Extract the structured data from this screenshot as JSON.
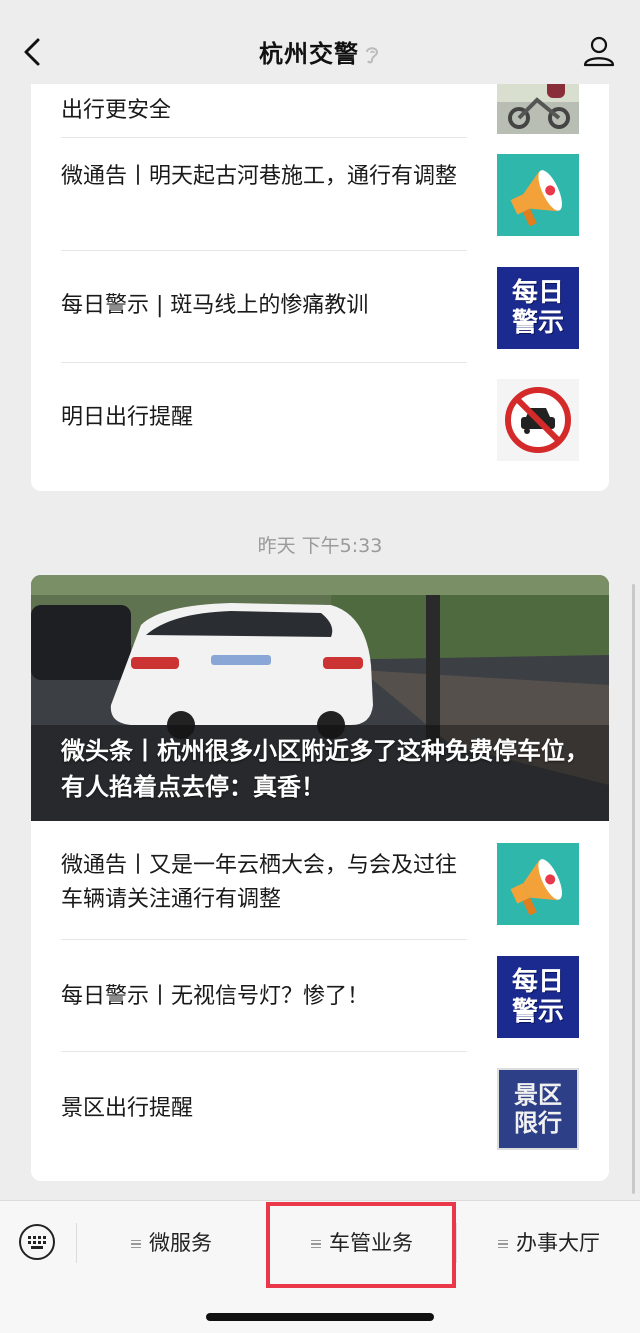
{
  "header": {
    "title": "杭州交警"
  },
  "card1": {
    "items": [
      {
        "title": "出行更安全",
        "thumb": "scooter-photo"
      },
      {
        "title": "微通告丨明天起古河巷施工，通行有调整",
        "thumb": "megaphone-icon"
      },
      {
        "title": "每日警示 | 斑马线上的惨痛教训",
        "thumb": "daily-warning",
        "thumb_text": [
          "每日",
          "警示"
        ]
      },
      {
        "title": "明日出行提醒",
        "thumb": "no-car-sign"
      }
    ]
  },
  "timestamp": "昨天 下午5:33",
  "card2": {
    "hero_caption": "微头条丨杭州很多小区附近多了这种免费停车位，有人掐着点去停：真香！",
    "items": [
      {
        "title": "微通告丨又是一年云栖大会，与会及过往车辆请关注通行有调整",
        "thumb": "megaphone-icon"
      },
      {
        "title": "每日警示丨无视信号灯？惨了！",
        "thumb": "daily-warning",
        "thumb_text": [
          "每日",
          "警示"
        ]
      },
      {
        "title": "景区出行提醒",
        "thumb": "scenic-restriction",
        "thumb_text": [
          "景区",
          "限行"
        ]
      }
    ]
  },
  "bottom_menu": {
    "items": [
      "微服务",
      "车管业务",
      "办事大厅"
    ]
  },
  "colors": {
    "highlight": "#e8384a",
    "thumb_teal": "#2fb7ac",
    "thumb_blue": "#1b2a8f"
  }
}
